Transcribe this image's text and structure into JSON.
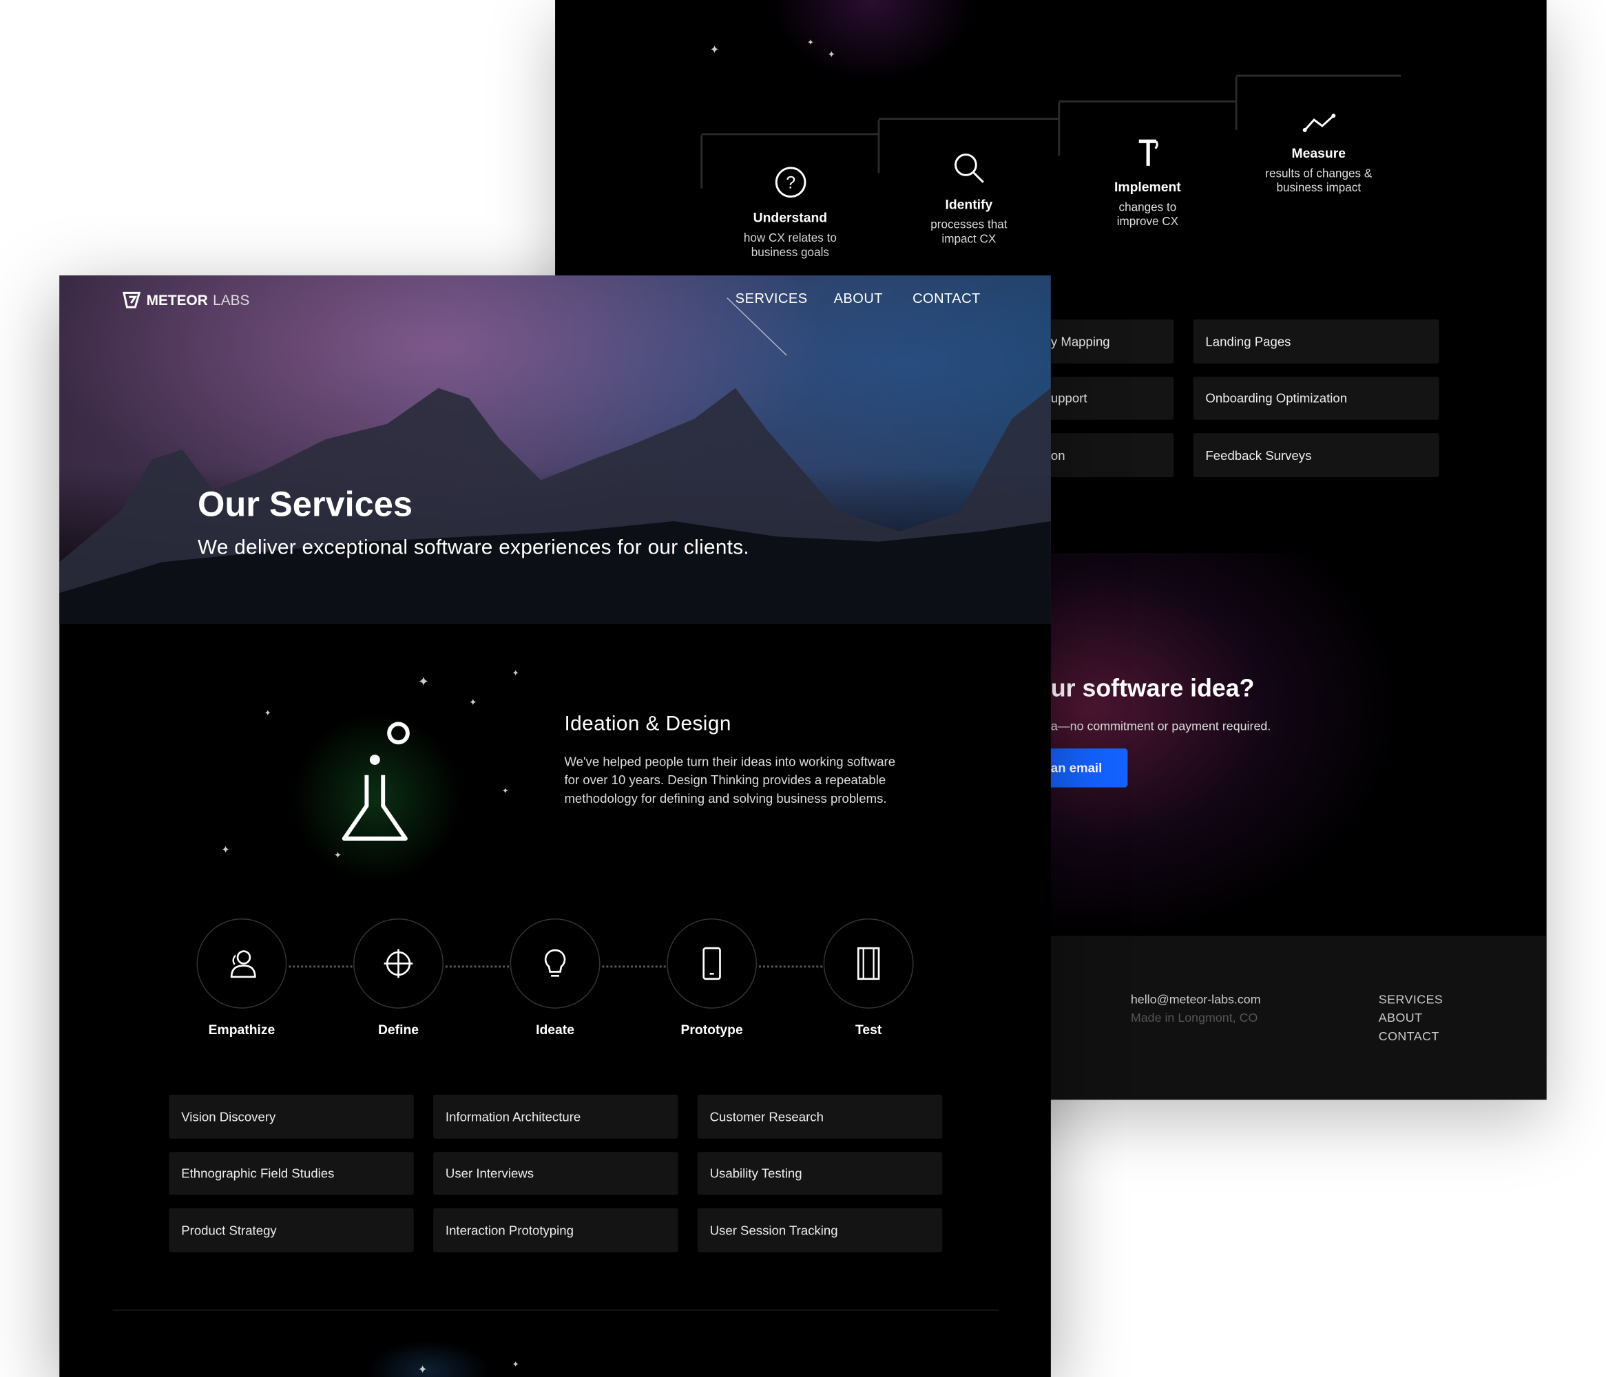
{
  "back_page": {
    "steps": [
      {
        "title": "Understand",
        "desc": "how CX relates to business goals",
        "icon": "question-circle-icon"
      },
      {
        "title": "Identify",
        "desc": "processes that impact CX",
        "icon": "search-icon"
      },
      {
        "title": "Implement",
        "desc": "changes to improve CX",
        "icon": "hammer-icon"
      },
      {
        "title": "Measure",
        "desc": "results of changes & business impact",
        "icon": "trend-line-icon"
      }
    ],
    "services_partial": [
      "y Mapping",
      "upport",
      "on"
    ],
    "services": [
      "Landing Pages",
      "Onboarding Optimization",
      "Feedback Surveys"
    ],
    "cta": {
      "title": "ur software idea?",
      "subtitle": "a—no commitment or payment required.",
      "button": "an email",
      "button_color": "#1463ff"
    },
    "footer": {
      "email": "hello@meteor-labs.com",
      "location": "Made in Longmont, CO",
      "links": [
        "SERVICES",
        "ABOUT",
        "CONTACT"
      ]
    }
  },
  "front_page": {
    "logo": {
      "bold": "METEOR",
      "light": "LABS"
    },
    "nav": [
      "SERVICES",
      "ABOUT",
      "CONTACT"
    ],
    "hero": {
      "title": "Our Services",
      "subtitle": "We deliver exceptional software experiences for our clients."
    },
    "section": {
      "title": "Ideation & Design",
      "body": "We've helped people turn their ideas into working software for over 10 years. Design Thinking provides a repeatable methodology for defining and solving business problems.",
      "icon": "flask-icon",
      "glow_color": "#3cff6a"
    },
    "process": [
      {
        "label": "Empathize",
        "icon": "users-icon"
      },
      {
        "label": "Define",
        "icon": "crosshair-icon"
      },
      {
        "label": "Ideate",
        "icon": "lightbulb-icon"
      },
      {
        "label": "Prototype",
        "icon": "phone-icon"
      },
      {
        "label": "Test",
        "icon": "notebook-icon"
      }
    ],
    "services": [
      "Vision Discovery",
      "Information Architecture",
      "Customer Research",
      "Ethnographic Field Studies",
      "User Interviews",
      "Usability Testing",
      "Product Strategy",
      "Interaction Prototyping",
      "User Session Tracking"
    ]
  }
}
